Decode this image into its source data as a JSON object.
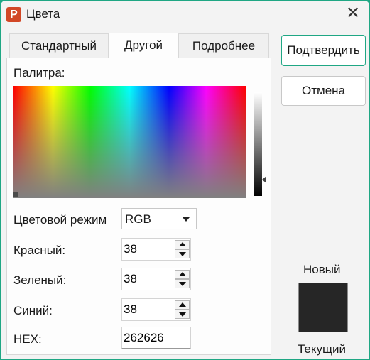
{
  "window": {
    "title": "Цвета",
    "app_icon_letter": "P"
  },
  "tabs": [
    {
      "label": "Стандартный",
      "active": false
    },
    {
      "label": "Другой",
      "active": true
    },
    {
      "label": "Подробнее",
      "active": false
    }
  ],
  "palette": {
    "label": "Палитра:"
  },
  "color_mode": {
    "label": "Цветовой режим",
    "value": "RGB"
  },
  "channels": {
    "red": {
      "label": "Красный:",
      "value": "38"
    },
    "green": {
      "label": "Зеленый:",
      "value": "38"
    },
    "blue": {
      "label": "Синий:",
      "value": "38"
    }
  },
  "hex": {
    "label": "HEX:",
    "value": "262626"
  },
  "buttons": {
    "confirm": "Подтвердить",
    "cancel": "Отмена"
  },
  "preview": {
    "new_label": "Новый",
    "current_label": "Текущий",
    "new_color": "#262626"
  },
  "colors": {
    "accent": "#1fa784",
    "app_icon": "#d24726"
  }
}
